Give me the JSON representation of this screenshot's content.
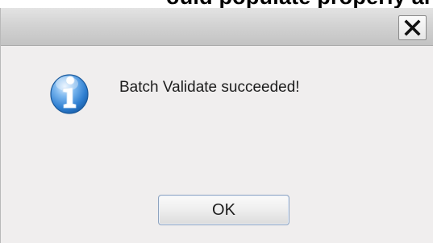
{
  "page": {
    "partial_heading": "ould populate properly and"
  },
  "dialog": {
    "message": "Batch Validate succeeded!",
    "ok_label": "OK",
    "icon": "info-icon",
    "close_icon": "close-icon"
  },
  "colors": {
    "dialog_background": "#f0eeee",
    "titlebar": "#d3d3d3",
    "info_icon_blue": "#2f7fd1",
    "ok_border": "#8ea3bf"
  }
}
